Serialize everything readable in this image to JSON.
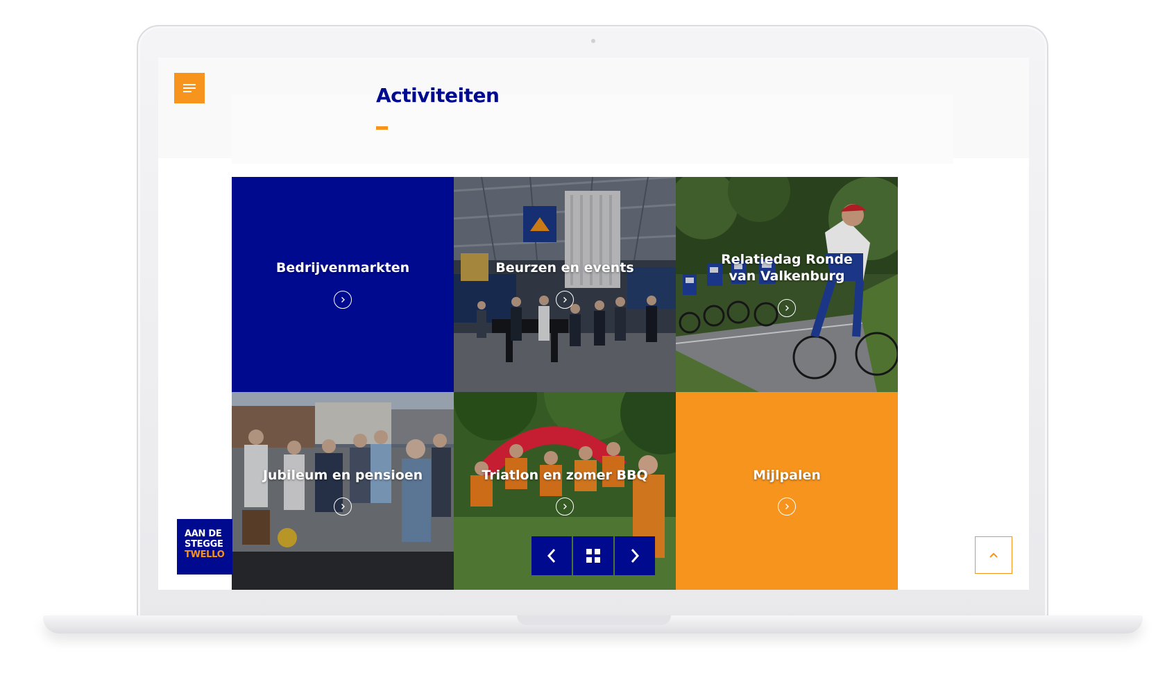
{
  "page": {
    "title": "Activiteiten"
  },
  "colors": {
    "brand_blue": "#000a8f",
    "brand_orange": "#f7941d",
    "white": "#ffffff"
  },
  "header": {
    "menu_icon": "hamburger-menu-icon"
  },
  "tiles": [
    {
      "label": "Bedrijvenmarkten",
      "arrow_icon": "chevron-right-circle-icon",
      "style": "solid-blue"
    },
    {
      "label": "Beurzen en events",
      "arrow_icon": "chevron-right-circle-icon",
      "style": "photo-exhibition-hall"
    },
    {
      "label": "Relatiedag Ronde van Valkenburg",
      "arrow_icon": "chevron-right-circle-icon",
      "style": "photo-cyclists"
    },
    {
      "label": "Jubileum en pensioen",
      "arrow_icon": "chevron-right-circle-icon",
      "style": "photo-outdoor-gathering"
    },
    {
      "label": "Triatlon en zomer BBQ",
      "arrow_icon": "chevron-right-circle-icon",
      "style": "photo-runners"
    },
    {
      "label": "Mijlpalen",
      "arrow_icon": "chevron-right-circle-icon",
      "style": "solid-orange"
    }
  ],
  "logo": {
    "line1": "AAN DE",
    "line2": "STEGGE",
    "line3": "TWELLO"
  },
  "slider_nav": {
    "prev_icon": "chevron-left-icon",
    "grid_icon": "grid-icon",
    "next_icon": "chevron-right-icon"
  },
  "scroll_top": {
    "icon": "chevron-up-icon"
  }
}
